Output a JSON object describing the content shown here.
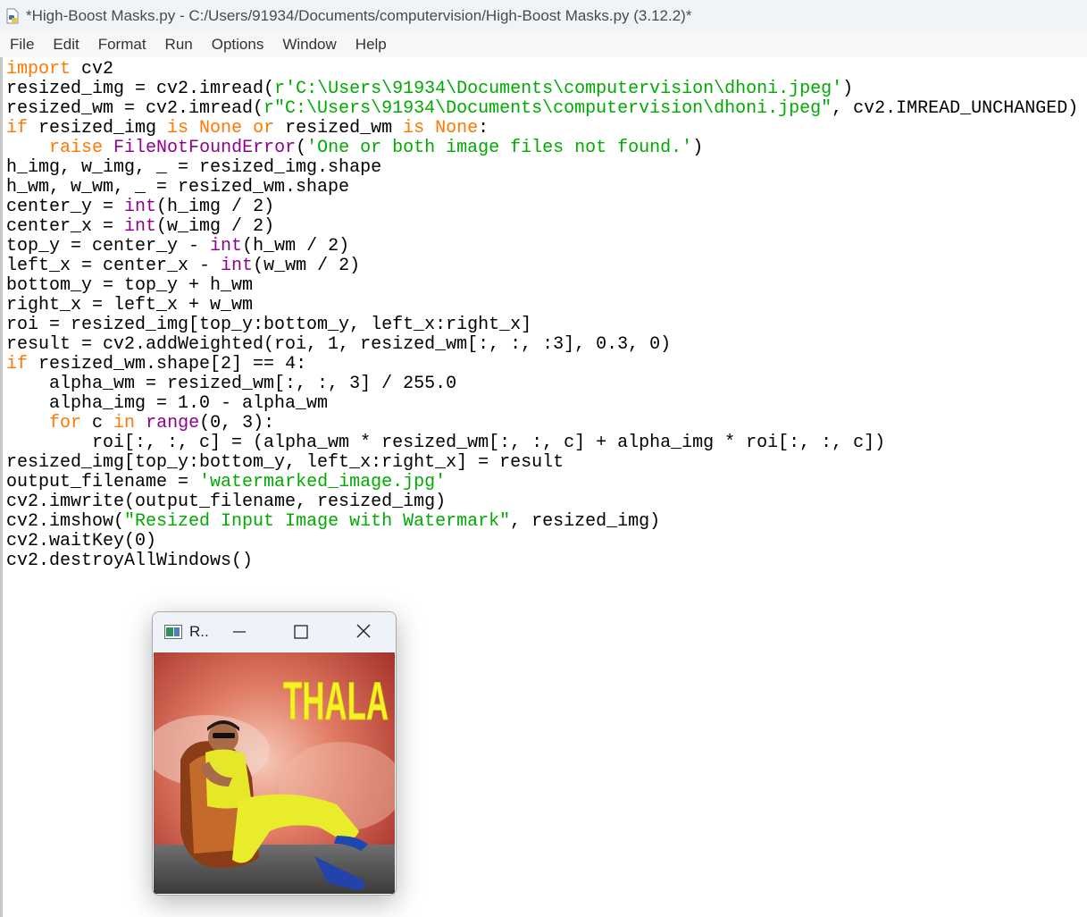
{
  "window": {
    "title": "*High-Boost Masks.py - C:/Users/91934/Documents/computervision/High-Boost Masks.py (3.12.2)*"
  },
  "menu": {
    "items": [
      "File",
      "Edit",
      "Format",
      "Run",
      "Options",
      "Window",
      "Help"
    ]
  },
  "code_lines": [
    [
      {
        "t": "import",
        "c": "kw"
      },
      {
        "t": " cv2"
      }
    ],
    [
      {
        "t": "resized_img = cv2.imread("
      },
      {
        "t": "r'C:\\Users\\91934\\Documents\\computervision\\dhoni.jpeg'",
        "c": "st"
      },
      {
        "t": ")"
      }
    ],
    [
      {
        "t": "resized_wm = cv2.imread("
      },
      {
        "t": "r\"C:\\Users\\91934\\Documents\\computervision\\dhoni.jpeg\"",
        "c": "st"
      },
      {
        "t": ", cv2.IMREAD_UNCHANGED)"
      }
    ],
    [
      {
        "t": "if",
        "c": "kw"
      },
      {
        "t": " resized_img "
      },
      {
        "t": "is None or",
        "c": "kw"
      },
      {
        "t": " resized_wm "
      },
      {
        "t": "is None",
        "c": "kw"
      },
      {
        "t": ":"
      }
    ],
    [
      {
        "t": "    "
      },
      {
        "t": "raise",
        "c": "kw"
      },
      {
        "t": " "
      },
      {
        "t": "FileNotFoundError",
        "c": "bi"
      },
      {
        "t": "("
      },
      {
        "t": "'One or both image files not found.'",
        "c": "st"
      },
      {
        "t": ")"
      }
    ],
    [
      {
        "t": "h_img, w_img, _ = resized_img.shape"
      }
    ],
    [
      {
        "t": "h_wm, w_wm, _ = resized_wm.shape"
      }
    ],
    [
      {
        "t": "center_y = "
      },
      {
        "t": "int",
        "c": "bi"
      },
      {
        "t": "(h_img / 2)"
      }
    ],
    [
      {
        "t": "center_x = "
      },
      {
        "t": "int",
        "c": "bi"
      },
      {
        "t": "(w_img / 2)"
      }
    ],
    [
      {
        "t": "top_y = center_y - "
      },
      {
        "t": "int",
        "c": "bi"
      },
      {
        "t": "(h_wm / 2)"
      }
    ],
    [
      {
        "t": "left_x = center_x - "
      },
      {
        "t": "int",
        "c": "bi"
      },
      {
        "t": "(w_wm / 2)"
      }
    ],
    [
      {
        "t": "bottom_y = top_y + h_wm"
      }
    ],
    [
      {
        "t": "right_x = left_x + w_wm"
      }
    ],
    [
      {
        "t": "roi = resized_img[top_y:bottom_y, left_x:right_x]"
      }
    ],
    [
      {
        "t": "result = cv2.addWeighted(roi, 1, resized_wm[:, :, :3], 0.3, 0)"
      }
    ],
    [
      {
        "t": "if",
        "c": "kw"
      },
      {
        "t": " resized_wm.shape[2] == 4:"
      }
    ],
    [
      {
        "t": "    alpha_wm = resized_wm[:, :, 3] / 255.0"
      }
    ],
    [
      {
        "t": "    alpha_img = 1.0 - alpha_wm"
      }
    ],
    [
      {
        "t": "    "
      },
      {
        "t": "for",
        "c": "kw"
      },
      {
        "t": " c "
      },
      {
        "t": "in",
        "c": "kw"
      },
      {
        "t": " "
      },
      {
        "t": "range",
        "c": "bi"
      },
      {
        "t": "(0, 3):"
      }
    ],
    [
      {
        "t": "        roi[:, :, c] = (alpha_wm * resized_wm[:, :, c] + alpha_img * roi[:, :, c])"
      }
    ],
    [
      {
        "t": "resized_img[top_y:bottom_y, left_x:right_x] = result"
      }
    ],
    [
      {
        "t": "output_filename = "
      },
      {
        "t": "'watermarked_image.jpg'",
        "c": "st"
      }
    ],
    [
      {
        "t": "cv2.imwrite(output_filename, resized_img)"
      }
    ],
    [
      {
        "t": "cv2.imshow("
      },
      {
        "t": "\"Resized Input Image with Watermark\"",
        "c": "st"
      },
      {
        "t": ", resized_img)"
      }
    ],
    [
      {
        "t": "cv2.waitKey(0)"
      }
    ],
    [
      {
        "t": "cv2.destroyAllWindows()"
      }
    ]
  ],
  "cv_window": {
    "title": "R..",
    "image_text": "THALA"
  },
  "icons": {
    "app": "python-file-icon",
    "cv_app": "opencv-window-icon",
    "minimize": "minimize-icon",
    "maximize": "maximize-icon",
    "close": "close-icon"
  },
  "colors": {
    "keyword": "#ff7700",
    "builtin": "#900090",
    "string": "#00aa00",
    "default": "#000000"
  }
}
